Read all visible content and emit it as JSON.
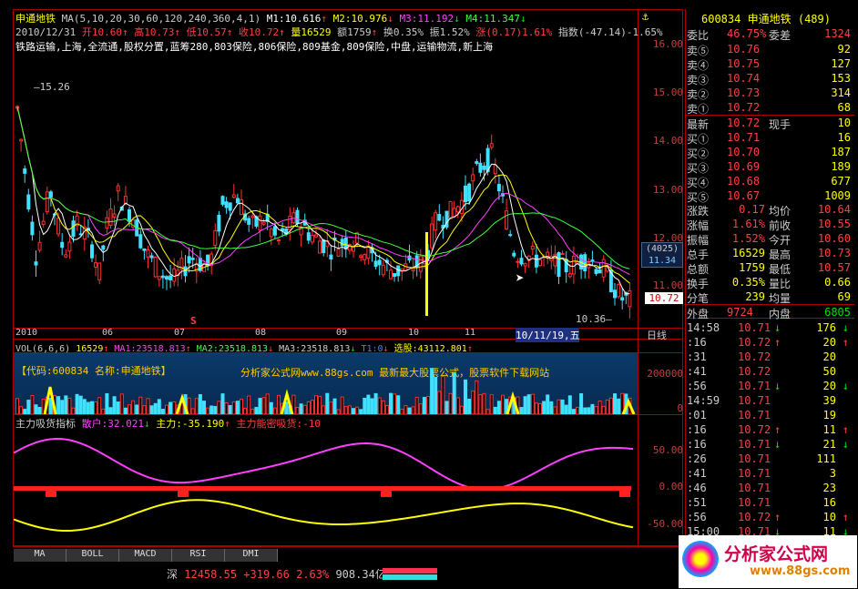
{
  "header": {
    "stock_name": "申通地铁",
    "ma_params": "MA(5,10,20,30,60,120,240,360,4,1)",
    "m1": "M1:10.616",
    "m2": "M2:10.976",
    "m3": "M3:11.192",
    "m4": "M4:11.347",
    "date": "2010/12/31",
    "open": "开10.60",
    "high": "高10.73",
    "low": "低10.57",
    "close": "收10.72",
    "volume": "量16529",
    "amount": "额1759",
    "turnover": "换0.35%",
    "amplitude": "振1.52%",
    "change": "涨(0.17)1.61%",
    "index_change": "指数(-47.14)-1.65%",
    "concepts": "铁路运输,上海,全流通,股权分置,蓝筹280,803保险,806保险,809基金,809保险,中盘,运输物流,新上海"
  },
  "price_axis": [
    "16.00",
    "15.00",
    "14.00",
    "13.00",
    "12.00",
    "11.00"
  ],
  "price_box": {
    "count": "(4025)",
    "value": "11.34",
    "last": "10.72"
  },
  "annotations": {
    "high": "15.26",
    "low": "10.36",
    "cursor_date": "10/11/19,五",
    "period": "日线"
  },
  "months": [
    "2010",
    "06",
    "07",
    "08",
    "09",
    "10",
    "11"
  ],
  "volume_header": {
    "vol": "VOL(6,6,6)",
    "vol_val": "16529",
    "ma1": "MA1:23518.813",
    "ma2": "MA2:23518.813",
    "ma3": "MA3:23518.813",
    "t1": "T1:0",
    "pick": "选股:43112.801"
  },
  "watermark": {
    "code": "【代码:600834 名称:申通地铁】",
    "site": "分析家公式网www.88gs.com  最新最大股票公式，股票软件下载网站"
  },
  "volume_axis": [
    "200000",
    "0"
  ],
  "indicator_header": {
    "name": "主力吸货指标",
    "retail": "散户:32.021",
    "main": "主力:-35.190",
    "accum": "主力能密吸货:-10"
  },
  "indicator_axis": [
    "50.00",
    "0.00",
    "-50.00"
  ],
  "tabs": [
    "MA",
    "BOLL",
    "MACD",
    "RSI",
    "DMI"
  ],
  "quote": {
    "code": "600834",
    "name": "申通地铁",
    "num": "(489)",
    "wb_label": "委比",
    "wb": "46.75%",
    "wc_label": "委差",
    "wc": "1324",
    "asks": [
      {
        "label": "卖⑤",
        "price": "10.76",
        "vol": "92"
      },
      {
        "label": "卖④",
        "price": "10.75",
        "vol": "127"
      },
      {
        "label": "卖③",
        "price": "10.74",
        "vol": "153"
      },
      {
        "label": "卖②",
        "price": "10.73",
        "vol": "314"
      },
      {
        "label": "卖①",
        "price": "10.72",
        "vol": "68"
      }
    ],
    "last_label": "最新",
    "last": "10.72",
    "hand_label": "现手",
    "hand": "10",
    "bids": [
      {
        "label": "买①",
        "price": "10.71",
        "vol": "16"
      },
      {
        "label": "买②",
        "price": "10.70",
        "vol": "187"
      },
      {
        "label": "买③",
        "price": "10.69",
        "vol": "189"
      },
      {
        "label": "买④",
        "price": "10.68",
        "vol": "677"
      },
      {
        "label": "买⑤",
        "price": "10.67",
        "vol": "1009"
      }
    ],
    "stats": [
      {
        "l1": "涨跌",
        "v1": "0.17",
        "l2": "均价",
        "v2": "10.64"
      },
      {
        "l1": "涨幅",
        "v1": "1.61%",
        "l2": "前收",
        "v2": "10.55"
      },
      {
        "l1": "振幅",
        "v1": "1.52%",
        "l2": "今开",
        "v2": "10.60"
      },
      {
        "l1": "总手",
        "v1": "16529",
        "l2": "最高",
        "v2": "10.73"
      },
      {
        "l1": "总额",
        "v1": "1759",
        "l2": "最低",
        "v2": "10.57"
      },
      {
        "l1": "换手",
        "v1": "0.35%",
        "l2": "量比",
        "v2": "0.66"
      },
      {
        "l1": "分笔",
        "v1": "239",
        "l2": "均量",
        "v2": "69"
      }
    ],
    "outer_label": "外盘",
    "outer": "9724",
    "inner_label": "内盘",
    "inner": "6805"
  },
  "ticks": [
    {
      "t": "14:58",
      "p": "10.71",
      "d": "↓",
      "v": "176"
    },
    {
      "t": ":16",
      "p": "10.72",
      "d": "↑",
      "v": "20"
    },
    {
      "t": ":31",
      "p": "10.72",
      "d": "",
      "v": "20"
    },
    {
      "t": ":41",
      "p": "10.72",
      "d": "",
      "v": "50"
    },
    {
      "t": ":56",
      "p": "10.71",
      "d": "↓",
      "v": "20"
    },
    {
      "t": "14:59",
      "p": "10.71",
      "d": "",
      "v": "39"
    },
    {
      "t": ":01",
      "p": "10.71",
      "d": "",
      "v": "19"
    },
    {
      "t": ":16",
      "p": "10.72",
      "d": "↑",
      "v": "11"
    },
    {
      "t": ":16",
      "p": "10.71",
      "d": "↓",
      "v": "21"
    },
    {
      "t": ":26",
      "p": "10.71",
      "d": "",
      "v": "111"
    },
    {
      "t": ":41",
      "p": "10.71",
      "d": "",
      "v": "3"
    },
    {
      "t": ":46",
      "p": "10.71",
      "d": "",
      "v": "23"
    },
    {
      "t": ":51",
      "p": "10.71",
      "d": "",
      "v": "16"
    },
    {
      "t": ":56",
      "p": "10.72",
      "d": "↑",
      "v": "10"
    },
    {
      "t": "15:00",
      "p": "10.71",
      "d": "↓",
      "v": "11"
    }
  ],
  "status": {
    "market": "深",
    "index": "12458.55",
    "change": "+319.66",
    "pct": "2.63%",
    "amount": "908.34亿"
  },
  "logo_text": "分析家公式网",
  "logo_url": "www.88gs.com",
  "colors": {
    "up": "#ff4040",
    "down": "#00e0e0",
    "yellow": "#ffff00",
    "magenta": "#ff40ff",
    "green": "#40ff40"
  }
}
